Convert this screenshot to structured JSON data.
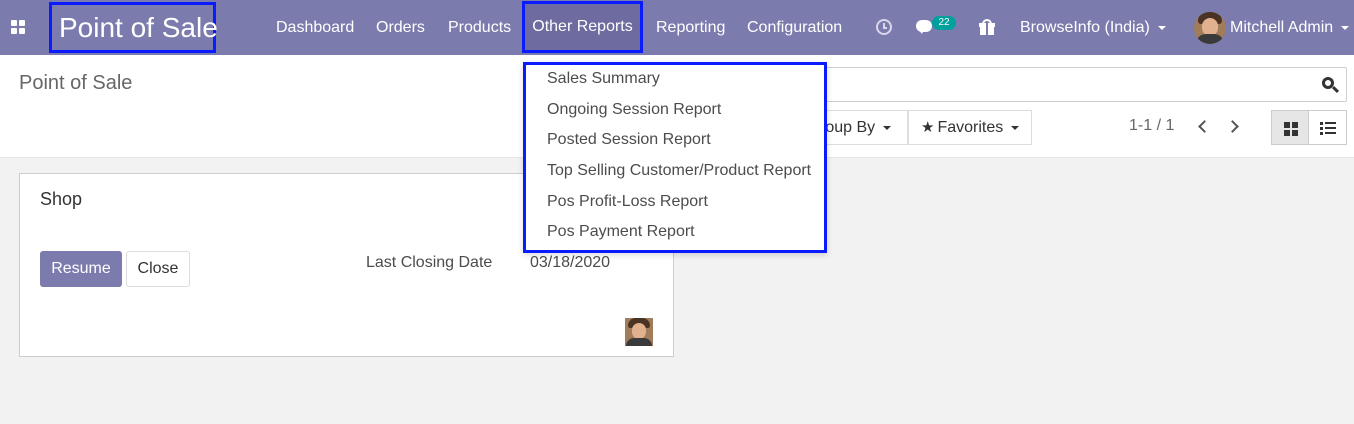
{
  "navbar": {
    "app_title": "Point of Sale",
    "menu": [
      "Dashboard",
      "Orders",
      "Products",
      "Other Reports",
      "Reporting",
      "Configuration"
    ],
    "active_menu": "Other Reports",
    "chat_count": "22",
    "company": "BrowseInfo (India)",
    "user": "Mitchell Admin",
    "icons": [
      "apps-icon",
      "clock-icon",
      "chat-icon",
      "gift-icon"
    ]
  },
  "control_panel": {
    "title": "Point of Sale",
    "group_by_label": "roup By",
    "favorites_label": "Favorites",
    "pager": "1-1 / 1"
  },
  "dropdown": {
    "items": [
      "Sales Summary",
      "Ongoing Session Report",
      "Posted Session Report",
      "Top Selling Customer/Product Report",
      "Pos Profit-Loss Report",
      "Pos Payment Report"
    ]
  },
  "card": {
    "title": "Shop",
    "resume_label": "Resume",
    "close_label": "Close",
    "last_closing_label": "Last Closing Date",
    "last_closing_value": "03/18/2020"
  },
  "colors": {
    "navbar": "#7c7bad",
    "highlight": "#0a1bff",
    "badge": "#00a09d"
  }
}
